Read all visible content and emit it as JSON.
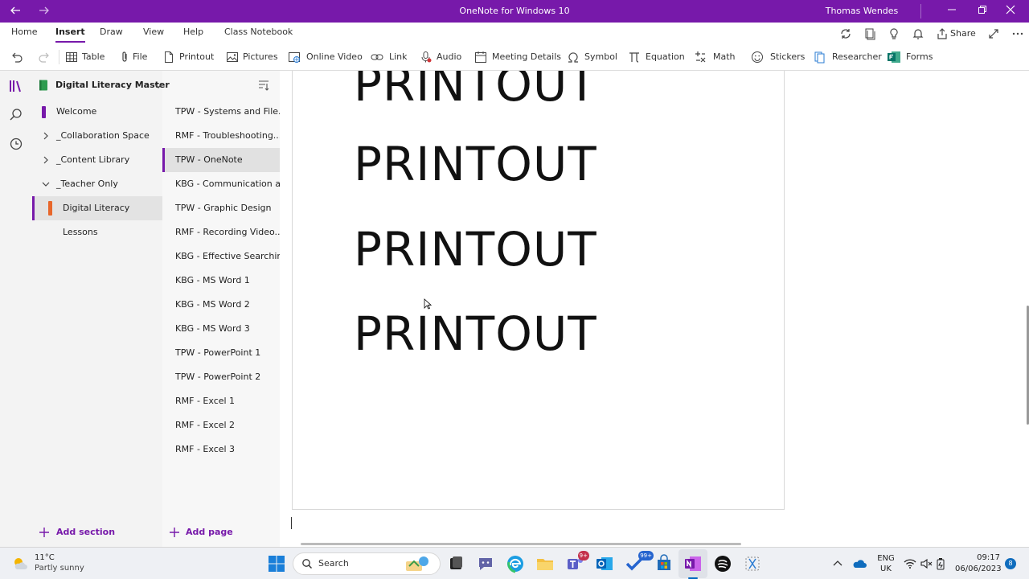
{
  "window": {
    "title": "OneNote for Windows 10",
    "user": "Thomas Wendes"
  },
  "ribbon_tabs": [
    "Home",
    "Insert",
    "Draw",
    "View",
    "Help",
    "Class Notebook"
  ],
  "ribbon_tools": {
    "share": "Share"
  },
  "insert_buttons": {
    "table": "Table",
    "file": "File",
    "printout": "Printout",
    "pictures": "Pictures",
    "online_video": "Online Video",
    "link": "Link",
    "audio": "Audio",
    "meeting_details": "Meeting Details",
    "symbol": "Symbol",
    "equation": "Equation",
    "math": "Math",
    "stickers": "Stickers",
    "researcher": "Researcher",
    "forms": "Forms"
  },
  "notebook": {
    "name": "Digital Literacy Master"
  },
  "sections": [
    "Welcome",
    "_Collaboration Space",
    "_Content Library",
    "_Teacher Only",
    "Digital Literacy Lessons"
  ],
  "pages": [
    "TPW - Systems and File...",
    "RMF - Troubleshooting...",
    "TPW - OneNote",
    "KBG - Communication a...",
    "TPW - Graphic Design",
    "RMF - Recording Video...",
    "KBG - Effective Searchin...",
    "KBG - MS Word 1",
    "KBG - MS Word 2",
    "KBG - MS Word 3",
    "TPW - PowerPoint 1",
    "TPW - PowerPoint 2",
    "RMF - Excel 1",
    "RMF - Excel 2",
    "RMF - Excel 3"
  ],
  "add_section": "Add section",
  "add_page": "Add page",
  "printout_lines": [
    "PRINTOUT",
    "PRINTOUT",
    "PRINTOUT",
    "PRINTOUT"
  ],
  "taskbar": {
    "weather_temp": "11°C",
    "weather_desc": "Partly sunny",
    "search": "Search",
    "teams_badge": "9+",
    "todo_badge": "99+",
    "lang1": "ENG",
    "lang2": "UK",
    "time": "09:17",
    "date": "06/06/2023",
    "notif": "8"
  },
  "colors": {
    "accent": "#7719aa",
    "section_orange": "#e8672b"
  }
}
